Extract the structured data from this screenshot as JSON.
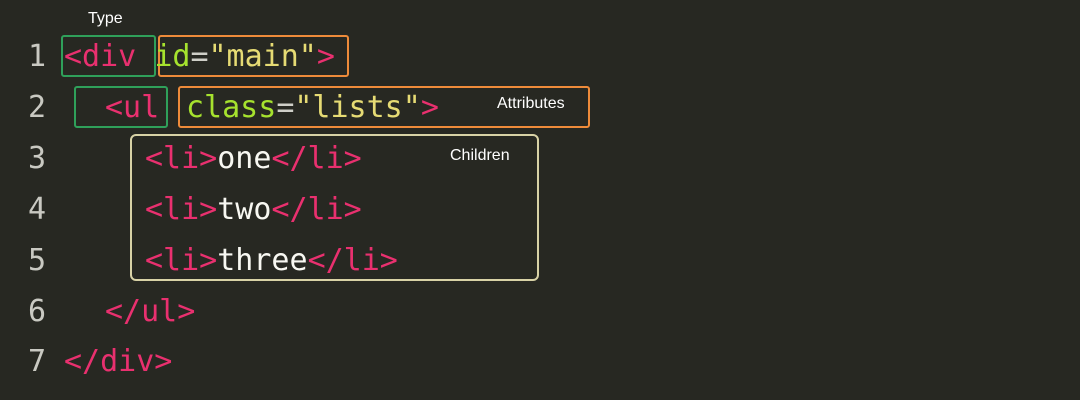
{
  "labels": {
    "type": "Type",
    "attributes": "Attributes",
    "children": "Children"
  },
  "lines": [
    {
      "number": "1",
      "open": "<div",
      "attr": "id",
      "eq": "=",
      "value": "\"main\"",
      "close": ">"
    },
    {
      "number": "2",
      "open": "<ul",
      "attr": "class",
      "eq": "=",
      "value": "\"lists\"",
      "close": ">"
    },
    {
      "number": "3",
      "open": "<li>",
      "text": "one",
      "close": "</li>"
    },
    {
      "number": "4",
      "open": "<li>",
      "text": "two",
      "close": "</li>"
    },
    {
      "number": "5",
      "open": "<li>",
      "text": "three",
      "close": "</li>"
    },
    {
      "number": "6",
      "open": "</ul>"
    },
    {
      "number": "7",
      "open": "</div>"
    }
  ],
  "colors": {
    "background": "#272822",
    "tag": "#e9306f",
    "attribute": "#a6e22e",
    "string": "#e6db74",
    "text": "#f8f8f2",
    "type_box": "#2fa05a",
    "attributes_box": "#ee8b3a",
    "children_box": "#d8d2a6"
  }
}
